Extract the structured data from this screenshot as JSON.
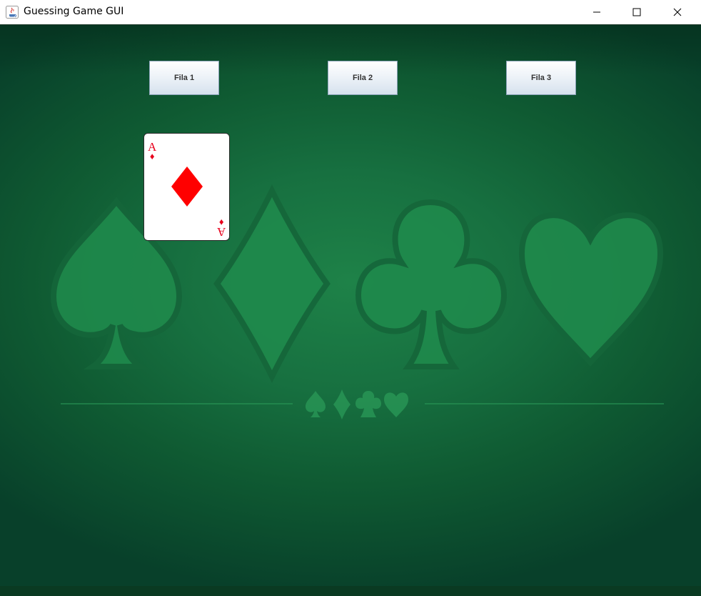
{
  "window": {
    "title": "Guessing Game GUI",
    "controls": [
      "minimize-icon",
      "maximize-icon",
      "close-icon"
    ]
  },
  "buttons": {
    "row1": "Fila 1",
    "row2": "Fila 2",
    "row3": "Fila 3"
  },
  "card": {
    "rank": "A",
    "suit": "diamonds",
    "pip": "♦",
    "color": "#e8001c"
  },
  "colors": {
    "felt": "#177040",
    "felt_dark": "#08402a",
    "suit_art": "#1f8a4c"
  }
}
